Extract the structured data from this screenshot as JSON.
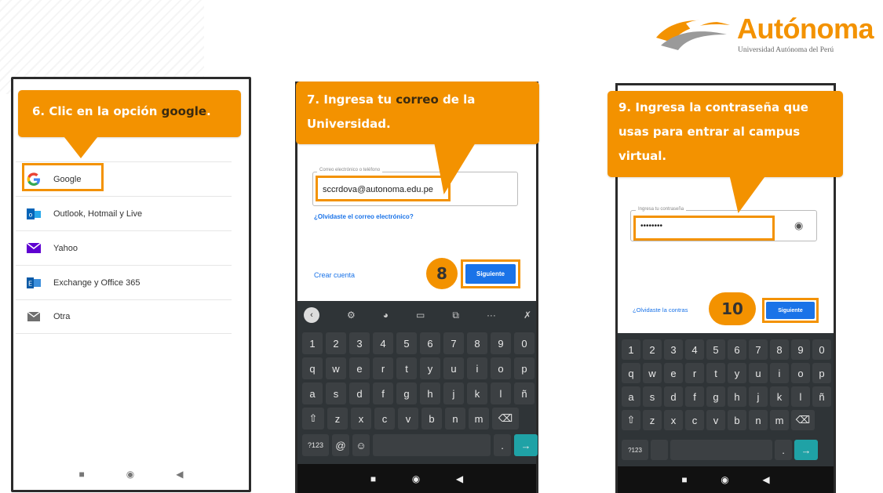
{
  "brand": {
    "name": "Autónoma",
    "subtitle": "Universidad Autónoma del Perú",
    "color": "#f39200"
  },
  "step6": {
    "callout_prefix": "6. Clic en la opción ",
    "callout_highlight": "google",
    "callout_suffix": ".",
    "accounts": [
      {
        "label": "Google",
        "icon": "google-icon"
      },
      {
        "label": "Outlook, Hotmail y Live",
        "icon": "outlook-icon"
      },
      {
        "label": "Yahoo",
        "icon": "yahoo-mail-icon"
      },
      {
        "label": "Exchange y Office 365",
        "icon": "exchange-icon"
      },
      {
        "label": "Otra",
        "icon": "mail-icon"
      }
    ]
  },
  "step7": {
    "callout_prefix": "7. Ingresa tu ",
    "callout_highlight": "correo",
    "callout_suffix": " de la",
    "callout_line2": "Universidad.",
    "field_label": "Correo electrónico o teléfono",
    "email_value": "sccrdova@autonoma.edu.pe",
    "forgot_email": "¿Olvidaste el correo electrónico?",
    "create_account": "Crear cuenta",
    "next_button": "Siguiente",
    "step8_number": "8"
  },
  "step9": {
    "callout_line1": "9. Ingresa la contraseña que",
    "callout_line2": "usas para entrar al campus",
    "callout_line3": "virtual.",
    "field_label": "Ingresa tu contraseña",
    "password_value": "••••••••",
    "forgot_password": "¿Olvidaste la contras",
    "next_button": "Siguiente",
    "step10_number": "10"
  },
  "keyboard": {
    "numbers": [
      "1",
      "2",
      "3",
      "4",
      "5",
      "6",
      "7",
      "8",
      "9",
      "0"
    ],
    "row1": [
      "q",
      "w",
      "e",
      "r",
      "t",
      "y",
      "u",
      "i",
      "o",
      "p"
    ],
    "row2": [
      "a",
      "s",
      "d",
      "f",
      "g",
      "h",
      "j",
      "k",
      "l",
      "ñ"
    ],
    "row3": [
      "z",
      "x",
      "c",
      "v",
      "b",
      "n",
      "m"
    ],
    "symbols_key": "?123",
    "at_key": "@",
    "period_key": "."
  }
}
